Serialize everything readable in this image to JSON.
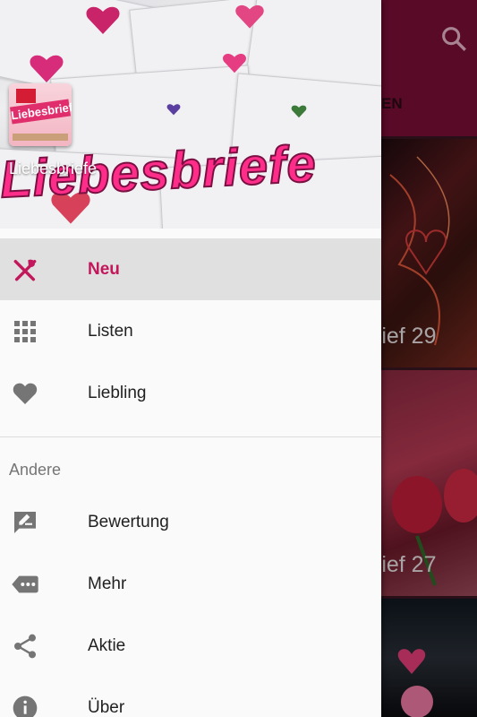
{
  "app": {
    "title": "Liebesbriefe",
    "header_image_text": "Liebesbriefe",
    "logo_text": "Liebesbriefe",
    "accent_color": "#c2185b",
    "appbar_color": "#7a0f37"
  },
  "background": {
    "tab_label": "EN",
    "cards": [
      {
        "title": "rief 29"
      },
      {
        "title": "rief 27"
      },
      {
        "title": ""
      }
    ]
  },
  "drawer": {
    "main_items": [
      {
        "label": "Neu",
        "icon": "fork-knife-icon",
        "active": true
      },
      {
        "label": "Listen",
        "icon": "grid-icon",
        "active": false
      },
      {
        "label": "Liebling",
        "icon": "heart-icon",
        "active": false
      }
    ],
    "section_title": "Andere",
    "other_items": [
      {
        "label": "Bewertung",
        "icon": "rate-review-icon"
      },
      {
        "label": "Mehr",
        "icon": "more-tag-icon"
      },
      {
        "label": "Aktie",
        "icon": "share-icon"
      },
      {
        "label": "Über",
        "icon": "info-icon"
      }
    ]
  }
}
